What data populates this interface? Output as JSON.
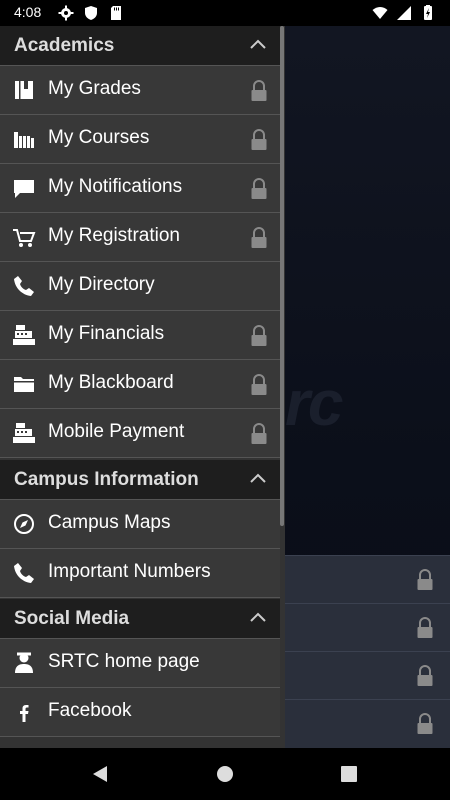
{
  "status_bar": {
    "time": "4:08",
    "left_icons": [
      "gear-icon",
      "shield-icon",
      "sd-card-icon"
    ],
    "right_icons": [
      "wifi-icon",
      "signal-icon",
      "battery-charging-icon"
    ]
  },
  "drawer": {
    "sections": [
      {
        "title": "Academics",
        "expanded": true,
        "items": [
          {
            "label": "My Grades",
            "icon": "book-icon",
            "locked": true
          },
          {
            "label": "My Courses",
            "icon": "books-icon",
            "locked": true
          },
          {
            "label": "My Notifications",
            "icon": "chat-bubble-icon",
            "locked": true
          },
          {
            "label": "My Registration",
            "icon": "cart-icon",
            "locked": true
          },
          {
            "label": "My Directory",
            "icon": "phone-icon",
            "locked": false
          },
          {
            "label": "My Financials",
            "icon": "cash-register-icon",
            "locked": true
          },
          {
            "label": "My Blackboard",
            "icon": "folder-icon",
            "locked": true
          },
          {
            "label": "Mobile Payment",
            "icon": "cash-register-icon",
            "locked": true
          }
        ]
      },
      {
        "title": "Campus Information",
        "expanded": true,
        "items": [
          {
            "label": "Campus Maps",
            "icon": "compass-icon",
            "locked": false
          },
          {
            "label": "Important Numbers",
            "icon": "phone-icon",
            "locked": false
          }
        ]
      },
      {
        "title": "Social Media",
        "expanded": true,
        "items": [
          {
            "label": "SRTC home page",
            "icon": "person-icon",
            "locked": false
          },
          {
            "label": "Facebook",
            "icon": "facebook-icon",
            "locked": false
          }
        ]
      }
    ]
  },
  "background": {
    "logo_text": "rc",
    "locked_rows": 4
  },
  "nav_bar": {
    "buttons": [
      "back-icon",
      "home-icon",
      "recents-icon"
    ]
  },
  "colors": {
    "drawer_bg": "#383838",
    "header_bg": "#1e1e1e",
    "divider": "#555555",
    "lock": "#8a8a8a"
  }
}
